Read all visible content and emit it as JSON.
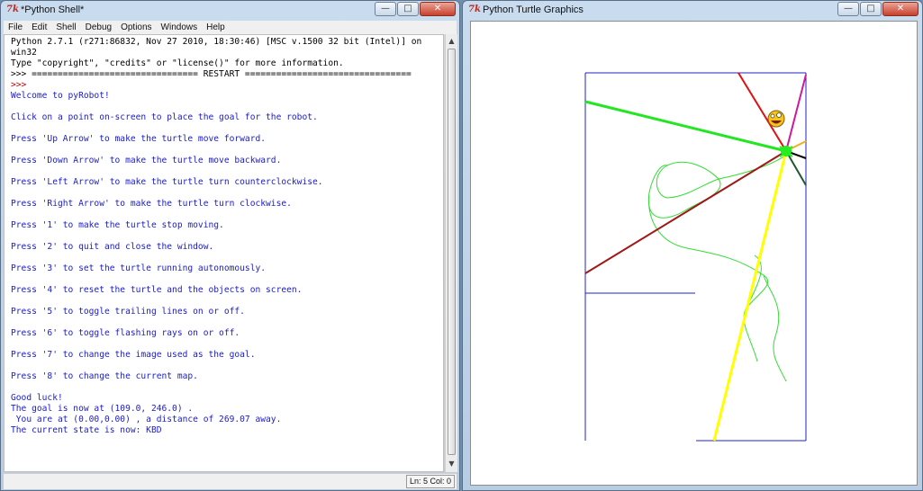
{
  "shell": {
    "title": "*Python Shell*",
    "menu": [
      "File",
      "Edit",
      "Shell",
      "Debug",
      "Options",
      "Windows",
      "Help"
    ],
    "lines": [
      {
        "text": "Python 2.7.1 (r271:86832, Nov 27 2010, 18:30:46) [MSC v.1500 32 bit (Intel)] on",
        "color": "black"
      },
      {
        "text": "win32",
        "color": "black"
      },
      {
        "text": "Type \"copyright\", \"credits\" or \"license()\" for more information.",
        "color": "black"
      },
      {
        "text": ">>> ================================ RESTART ================================",
        "color": "black"
      },
      {
        "text": ">>> ",
        "color": "red"
      },
      {
        "text": "Welcome to pyRobot!",
        "color": "blue"
      },
      {
        "text": "",
        "color": "blue"
      },
      {
        "text": "Click on a point on-screen to place the goal for the robot.",
        "color": "blue"
      },
      {
        "text": "",
        "color": "blue"
      },
      {
        "text": "Press 'Up Arrow' to make the turtle move forward.",
        "color": "blue"
      },
      {
        "text": "",
        "color": "blue"
      },
      {
        "text": "Press 'Down Arrow' to make the turtle move backward.",
        "color": "blue"
      },
      {
        "text": "",
        "color": "blue"
      },
      {
        "text": "Press 'Left Arrow' to make the turtle turn counterclockwise.",
        "color": "blue"
      },
      {
        "text": "",
        "color": "blue"
      },
      {
        "text": "Press 'Right Arrow' to make the turtle turn clockwise.",
        "color": "blue"
      },
      {
        "text": "",
        "color": "blue"
      },
      {
        "text": "Press '1' to make the turtle stop moving.",
        "color": "blue"
      },
      {
        "text": "",
        "color": "blue"
      },
      {
        "text": "Press '2' to quit and close the window.",
        "color": "blue"
      },
      {
        "text": "",
        "color": "blue"
      },
      {
        "text": "Press '3' to set the turtle running autonomously.",
        "color": "blue"
      },
      {
        "text": "",
        "color": "blue"
      },
      {
        "text": "Press '4' to reset the turtle and the objects on screen.",
        "color": "blue"
      },
      {
        "text": "",
        "color": "blue"
      },
      {
        "text": "Press '5' to toggle trailing lines on or off.",
        "color": "blue"
      },
      {
        "text": "",
        "color": "blue"
      },
      {
        "text": "Press '6' to toggle flashing rays on or off.",
        "color": "blue"
      },
      {
        "text": "",
        "color": "blue"
      },
      {
        "text": "Press '7' to change the image used as the goal.",
        "color": "blue"
      },
      {
        "text": "",
        "color": "blue"
      },
      {
        "text": "Press '8' to change the current map.",
        "color": "blue"
      },
      {
        "text": "",
        "color": "blue"
      },
      {
        "text": "Good luck!",
        "color": "blue"
      },
      {
        "text": "The goal is now at (109.0, 246.0) .",
        "color": "blue"
      },
      {
        "text": " You are at (0.00,0.00) , a distance of 269.07 away.",
        "color": "blue"
      },
      {
        "text": "The current state is now: KBD",
        "color": "blue"
      }
    ],
    "status": "Ln: 5 Col: 0"
  },
  "turtle": {
    "title": "Python Turtle Graphics"
  },
  "colors": {
    "map_wall": "#2020c8",
    "ray_green": "#22e622",
    "ray_red": "#e01010",
    "ray_magenta": "#cc1a9a",
    "ray_orange": "#f0b020",
    "ray_yellow": "#ffff00",
    "ray_darkred": "#a01818",
    "ray_black": "#000000",
    "ray_darkgreen": "#1f5a2a",
    "trail": "#33dd33",
    "robot": "#22ee22"
  },
  "icons": {
    "app": "tk-feather-icon",
    "goal": "smiley-goal-icon"
  }
}
